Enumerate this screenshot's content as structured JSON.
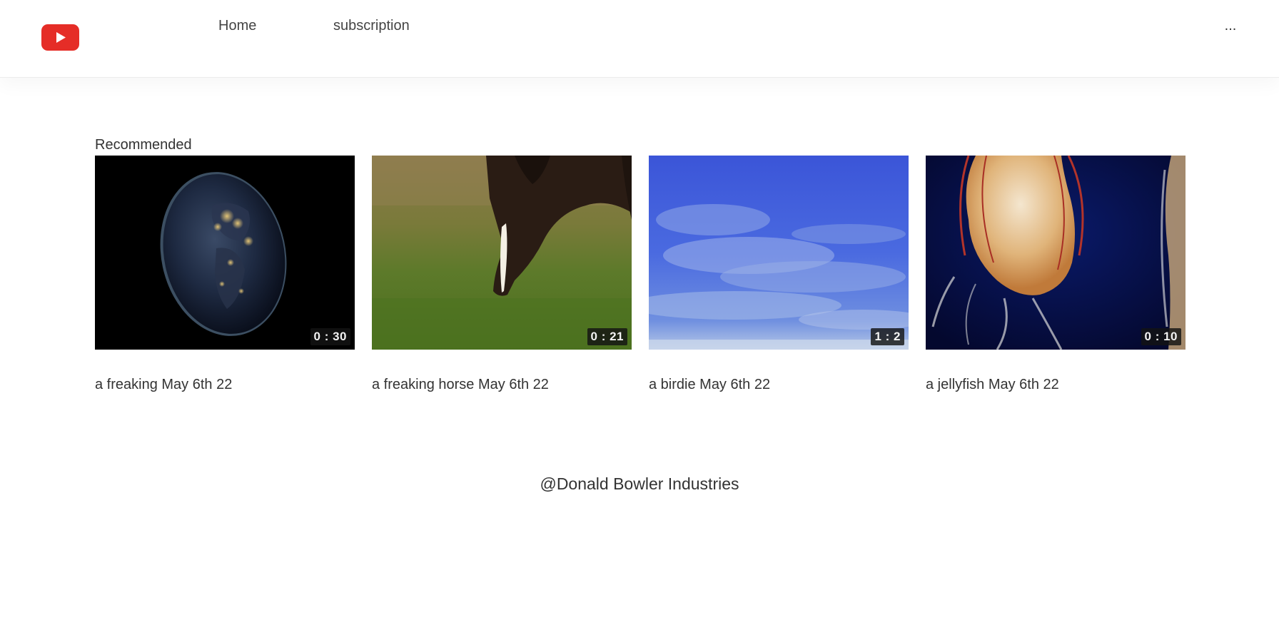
{
  "header": {
    "logo_icon": "youtube-play-icon",
    "brand_color": "#e52d27",
    "nav": [
      {
        "label": "Home"
      },
      {
        "label": "subscription"
      }
    ],
    "more_label": "..."
  },
  "main": {
    "section_title": "Recommended",
    "videos": [
      {
        "title": "a freaking May 6th 22",
        "duration": "0 : 30",
        "thumbnail": "earth-at-night"
      },
      {
        "title": "a freaking horse May 6th 22",
        "duration": "0 : 21",
        "thumbnail": "grazing-horse"
      },
      {
        "title": "a birdie May 6th 22",
        "duration": "1 : 2",
        "thumbnail": "blue-sky-clouds"
      },
      {
        "title": "a jellyfish May 6th 22",
        "duration": "0 : 10",
        "thumbnail": "jellyfish"
      }
    ]
  },
  "footer": {
    "text": "@Donald Bowler Industries"
  }
}
